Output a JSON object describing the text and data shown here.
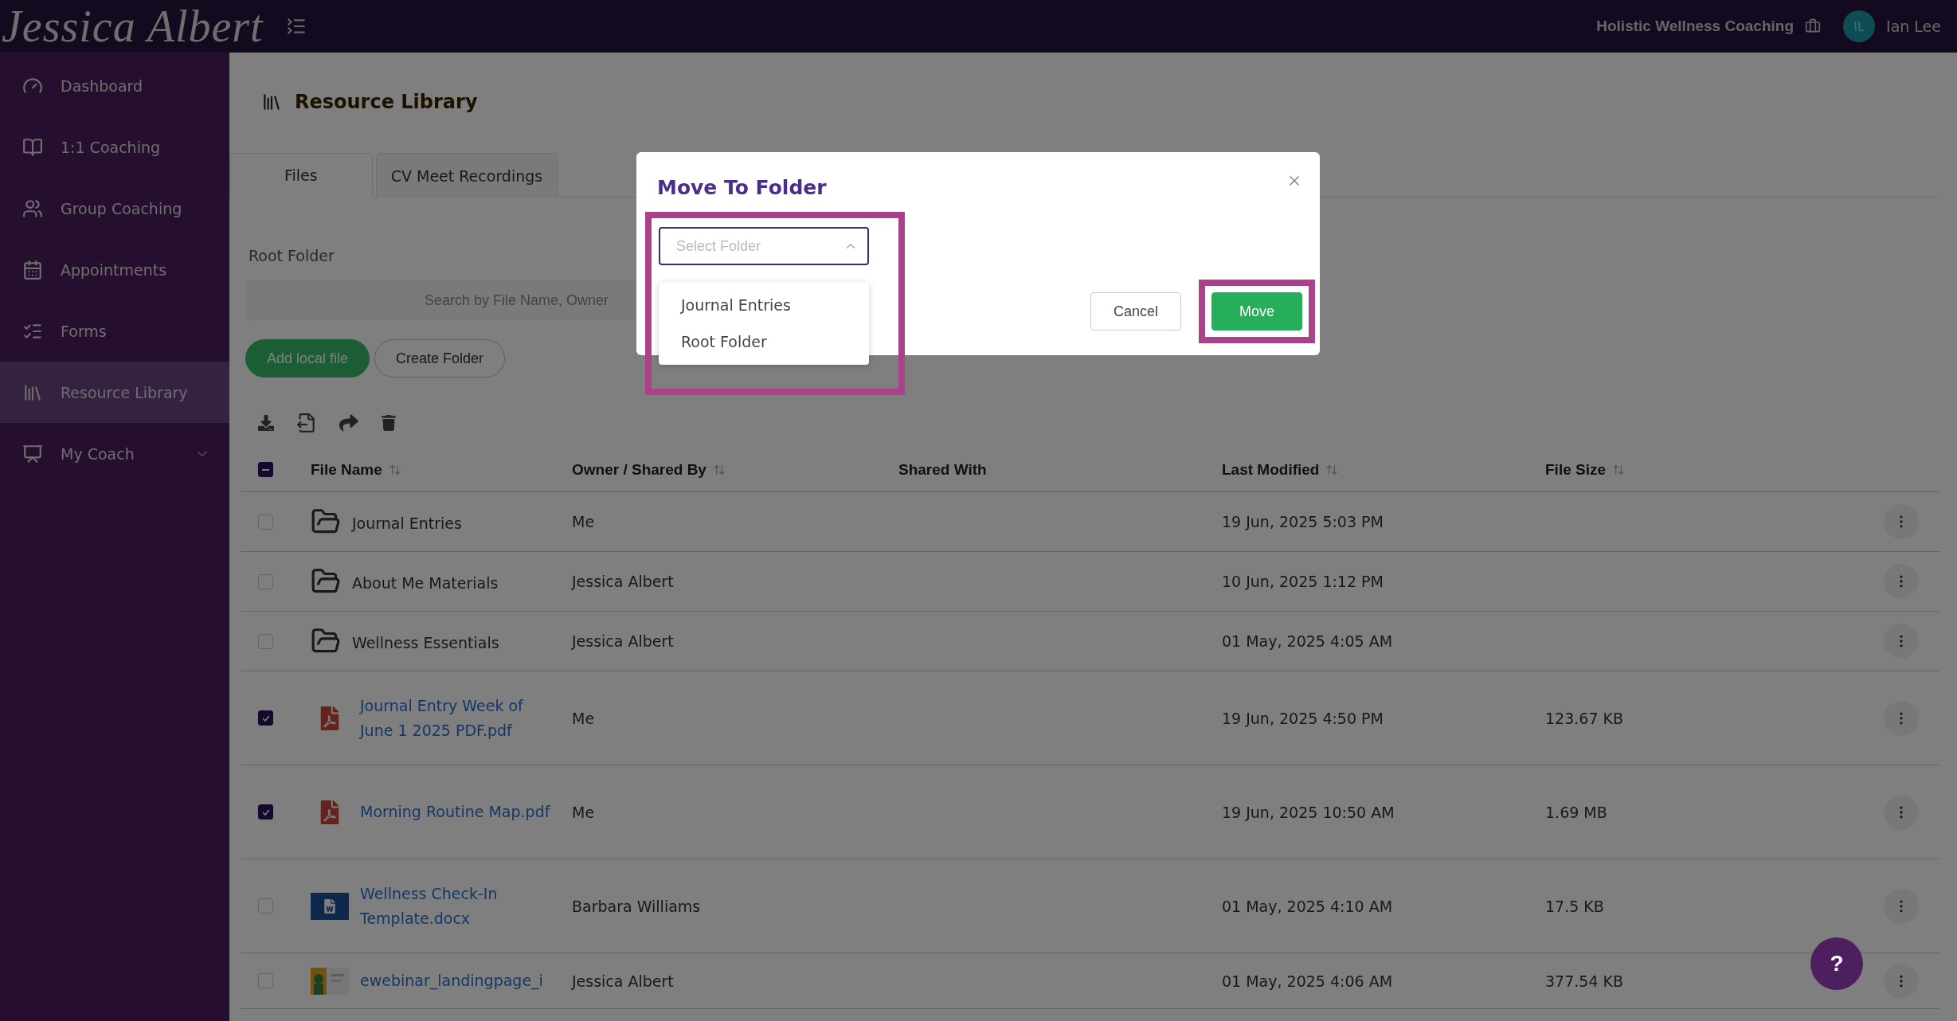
{
  "header": {
    "logo": "Jessica Albert",
    "org": "Holistic Wellness Coaching",
    "avatar_initials": "IL",
    "user": "Ian Lee"
  },
  "sidebar": {
    "items": [
      {
        "label": "Dashboard",
        "selected": false
      },
      {
        "label": "1:1 Coaching",
        "selected": false
      },
      {
        "label": "Group Coaching",
        "selected": false
      },
      {
        "label": "Appointments",
        "selected": false
      },
      {
        "label": "Forms",
        "selected": false
      },
      {
        "label": "Resource Library",
        "selected": true
      },
      {
        "label": "My Coach",
        "selected": false,
        "expanded": false
      }
    ]
  },
  "page": {
    "title": "Resource Library"
  },
  "tabs": [
    {
      "label": "Files",
      "selected": true
    },
    {
      "label": "CV Meet Recordings",
      "selected": false
    }
  ],
  "breadcrumb": "Root Folder",
  "search": {
    "placeholder": "Search by File Name, Owner"
  },
  "actions": [
    {
      "label": "Add local file",
      "kind": "primary"
    },
    {
      "label": "Create Folder",
      "kind": "secondary"
    }
  ],
  "table": {
    "select_all": {
      "indeterminate": true
    },
    "columns": [
      {
        "label": "File Name",
        "sortable": true
      },
      {
        "label": "Owner / Shared By",
        "sortable": true
      },
      {
        "label": "Shared With",
        "sortable": false
      },
      {
        "label": "Last Modified",
        "sortable": true
      },
      {
        "label": "File Size",
        "sortable": true
      }
    ],
    "rows": [
      {
        "checked": false,
        "kind": "folder",
        "name": "Journal Entries",
        "owner": "Me",
        "modified": "19 Jun, 2025 5:03 PM"
      },
      {
        "checked": false,
        "kind": "folder",
        "name": "About Me Materials",
        "owner": "Jessica Albert",
        "modified": "10 Jun, 2025 1:12 PM"
      },
      {
        "checked": false,
        "kind": "folder",
        "name": "Wellness Essentials",
        "owner": "Jessica Albert",
        "modified": "01 May, 2025 4:05 AM"
      },
      {
        "checked": true,
        "kind": "pdf",
        "name": "Journal Entry Week of June 1 2025 PDF.pdf",
        "owner": "Me",
        "modified": "19 Jun, 2025 4:50 PM",
        "size": "123.67 KB"
      },
      {
        "checked": true,
        "kind": "pdf",
        "name": "Morning Routine Map.pdf",
        "owner": "Me",
        "modified": "19 Jun, 2025 10:50 AM",
        "size": "1.69 MB"
      },
      {
        "checked": false,
        "kind": "word",
        "name": "Wellness Check-In Template.docx",
        "owner": "Barbara Williams",
        "modified": "01 May, 2025 4:10 AM",
        "size": "17.5 KB"
      },
      {
        "checked": false,
        "name": "ewebinar_landingpage_i",
        "owner": "Jessica Albert",
        "modified": "01 May, 2025 4:06 AM",
        "size": "377.54 KB"
      }
    ]
  },
  "modal": {
    "open": true,
    "title": "Move To Folder",
    "select": {
      "placeholder": "Select Folder",
      "open": true,
      "highlighted": true
    },
    "options": [
      "Journal Entries",
      "Root Folder"
    ],
    "buttons": [
      {
        "label": "Cancel",
        "kind": "secondary",
        "highlighted": false
      },
      {
        "label": "Move",
        "kind": "primary",
        "highlighted": true
      }
    ]
  },
  "help_button": {
    "label": "?"
  }
}
